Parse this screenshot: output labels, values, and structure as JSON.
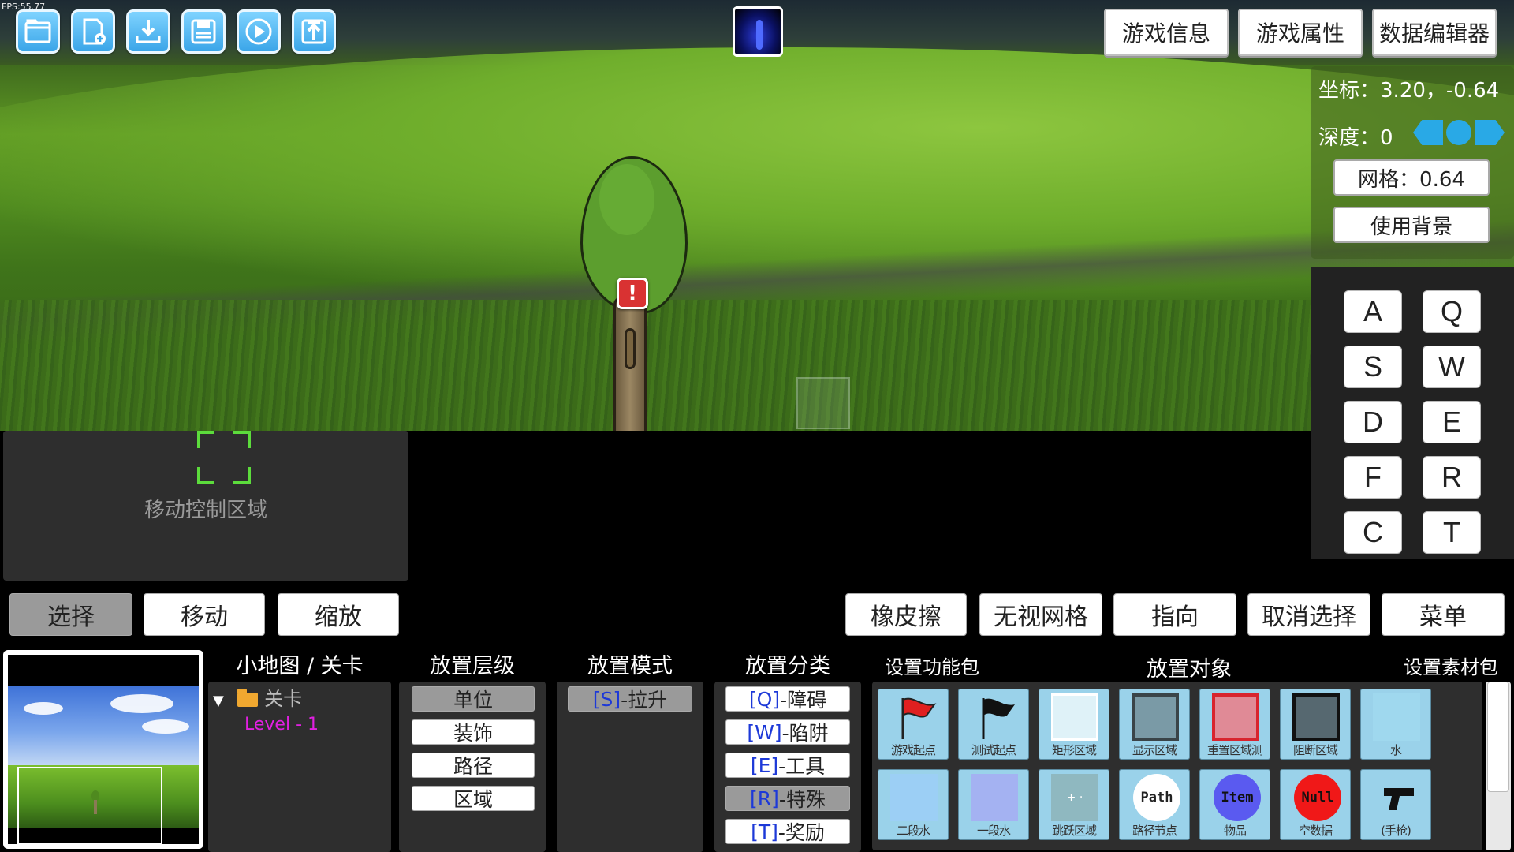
{
  "fps": "FPS:55.77",
  "toolbar": {
    "icons": [
      "open-folder-icon",
      "new-file-icon",
      "download-icon",
      "save-icon",
      "play-icon",
      "upload-icon"
    ],
    "top_buttons": [
      "游戏信息",
      "游戏属性",
      "数据编辑器"
    ]
  },
  "info": {
    "coord_label": "坐标：",
    "coord_value": "3.20，-0.64",
    "depth_label": "深度：",
    "depth_value": "0",
    "grid_button": "网格：0.64",
    "bg_button": "使用背景"
  },
  "keys": [
    "A",
    "Q",
    "S",
    "W",
    "D",
    "E",
    "F",
    "R",
    "C",
    "T"
  ],
  "move_area_label": "移动控制区域",
  "modes": [
    "选择",
    "移动",
    "缩放"
  ],
  "actions": [
    "橡皮擦",
    "无视网格",
    "指向",
    "取消选择",
    "菜单"
  ],
  "columns": {
    "minimap_title": "小地图 / 关卡",
    "layer_title": "放置层级",
    "mode_title": "放置模式",
    "category_title": "放置分类",
    "func_pack_title": "设置功能包",
    "object_title": "放置对象",
    "asset_pack_title": "设置素材包"
  },
  "level_tree": {
    "folder": "关卡",
    "level": "Level - 1"
  },
  "layers": [
    "单位",
    "装饰",
    "路径",
    "区域"
  ],
  "place_mode": {
    "hotkey": "[S]",
    "label": "-拉升"
  },
  "categories": [
    {
      "hotkey": "[Q]",
      "label": "-障碍"
    },
    {
      "hotkey": "[W]",
      "label": "-陷阱"
    },
    {
      "hotkey": "[E]",
      "label": "-工具"
    },
    {
      "hotkey": "[R]",
      "label": "-特殊"
    },
    {
      "hotkey": "[T]",
      "label": "-奖励"
    }
  ],
  "objects": [
    {
      "label": "游戏起点",
      "icon": "red-flag-icon"
    },
    {
      "label": "测试起点",
      "icon": "black-flag-icon"
    },
    {
      "label": "矩形区域",
      "icon": "rect-area-icon"
    },
    {
      "label": "显示区域",
      "icon": "display-area-icon"
    },
    {
      "label": "重置区域测",
      "icon": "reset-area-icon"
    },
    {
      "label": "阻断区域",
      "icon": "block-area-icon"
    },
    {
      "label": "水",
      "icon": "water-icon"
    },
    {
      "label": "二段水",
      "icon": "water2-icon"
    },
    {
      "label": "一段水",
      "icon": "water1-icon"
    },
    {
      "label": "跳跃区域",
      "icon": "jump-area-icon"
    },
    {
      "label": "路径节点",
      "icon": "path-node-icon",
      "badge": "Path"
    },
    {
      "label": "物品",
      "icon": "item-icon",
      "badge": "Item"
    },
    {
      "label": "空数据",
      "icon": "null-icon",
      "badge": "Null"
    },
    {
      "label": "(手枪)",
      "icon": "pistol-icon"
    }
  ],
  "colors": {
    "accent": "#29a9e6",
    "hotkey": "#1d39d8",
    "level": "#e020e0",
    "target": "#5cdc3c"
  }
}
